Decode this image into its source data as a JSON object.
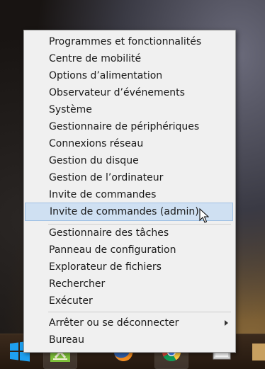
{
  "menu": {
    "groups": [
      {
        "items": [
          {
            "label": "Programmes et fonctionnalités"
          },
          {
            "label": "Centre de mobilité"
          },
          {
            "label": "Options d’alimentation"
          },
          {
            "label": "Observateur d’événements"
          },
          {
            "label": "Système"
          },
          {
            "label": "Gestionnaire de périphériques"
          },
          {
            "label": "Connexions réseau"
          },
          {
            "label": "Gestion du disque"
          },
          {
            "label": "Gestion de l’ordinateur"
          },
          {
            "label": "Invite de commandes"
          },
          {
            "label": "Invite de commandes (admin)",
            "highlighted": true
          }
        ]
      },
      {
        "items": [
          {
            "label": "Gestionnaire des tâches"
          },
          {
            "label": "Panneau de configuration"
          },
          {
            "label": "Explorateur de fichiers"
          },
          {
            "label": "Rechercher"
          },
          {
            "label": "Exécuter"
          }
        ]
      },
      {
        "items": [
          {
            "label": "Arrêter ou se déconnecter",
            "submenu": true
          },
          {
            "label": "Bureau"
          }
        ]
      }
    ],
    "highlight_color": "#cfe0f2",
    "highlight_border": "#9ec0e4"
  },
  "taskbar": {
    "start_icon": "windows-logo-icon",
    "apps": [
      {
        "icon": "app-green-x-icon"
      },
      {
        "icon": "firefox-icon"
      },
      {
        "icon": "chrome-icon"
      },
      {
        "icon": "window-app-icon"
      },
      {
        "icon": "partial-app-icon"
      }
    ]
  }
}
